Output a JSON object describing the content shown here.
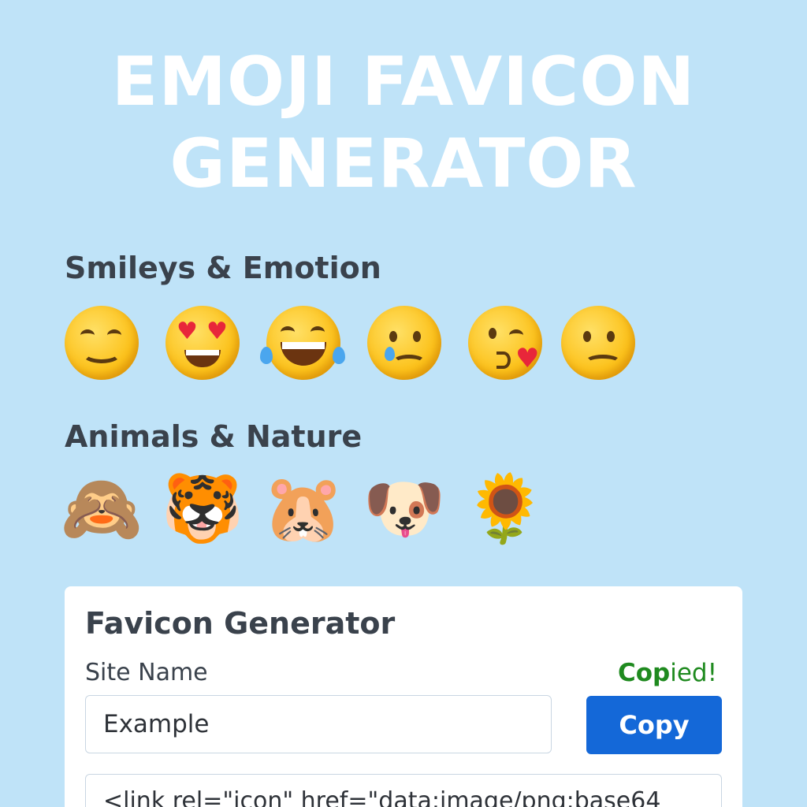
{
  "header": {
    "title_line1": "EMOJI FAVICON",
    "title_line2": "GENERATOR"
  },
  "categories": [
    {
      "name": "Smileys & Emotion",
      "emojis": [
        {
          "glyph": "😊",
          "icon": "smiling-face-icon"
        },
        {
          "glyph": "😍",
          "icon": "heart-eyes-face-icon"
        },
        {
          "glyph": "😂",
          "icon": "tears-of-joy-face-icon"
        },
        {
          "glyph": "😢",
          "icon": "crying-face-icon"
        },
        {
          "glyph": "😘",
          "icon": "blowing-kiss-face-icon"
        },
        {
          "glyph": "🙁",
          "icon": "frowning-face-icon"
        }
      ]
    },
    {
      "name": "Animals & Nature",
      "emojis": [
        {
          "glyph": "🙈",
          "icon": "see-no-evil-monkey-icon"
        },
        {
          "glyph": "🐯",
          "icon": "tiger-face-icon"
        },
        {
          "glyph": "🐹",
          "icon": "hamster-face-icon"
        },
        {
          "glyph": "🐶",
          "icon": "dog-face-icon"
        },
        {
          "glyph": "🌻",
          "icon": "sunflower-icon"
        }
      ]
    }
  ],
  "generator": {
    "title": "Favicon Generator",
    "site_name_label": "Site Name",
    "site_name_value": "Example",
    "copied_status_bold": "Cop",
    "copied_status_rest": "ied!",
    "copy_button_label": "Copy",
    "code_snippet": "<link rel=\"icon\" href=\"data:image/png;base64"
  },
  "colors": {
    "background": "#bfe3f8",
    "accent": "#1468d8",
    "success": "#1f8a1f",
    "heading_text": "#3a424c"
  }
}
